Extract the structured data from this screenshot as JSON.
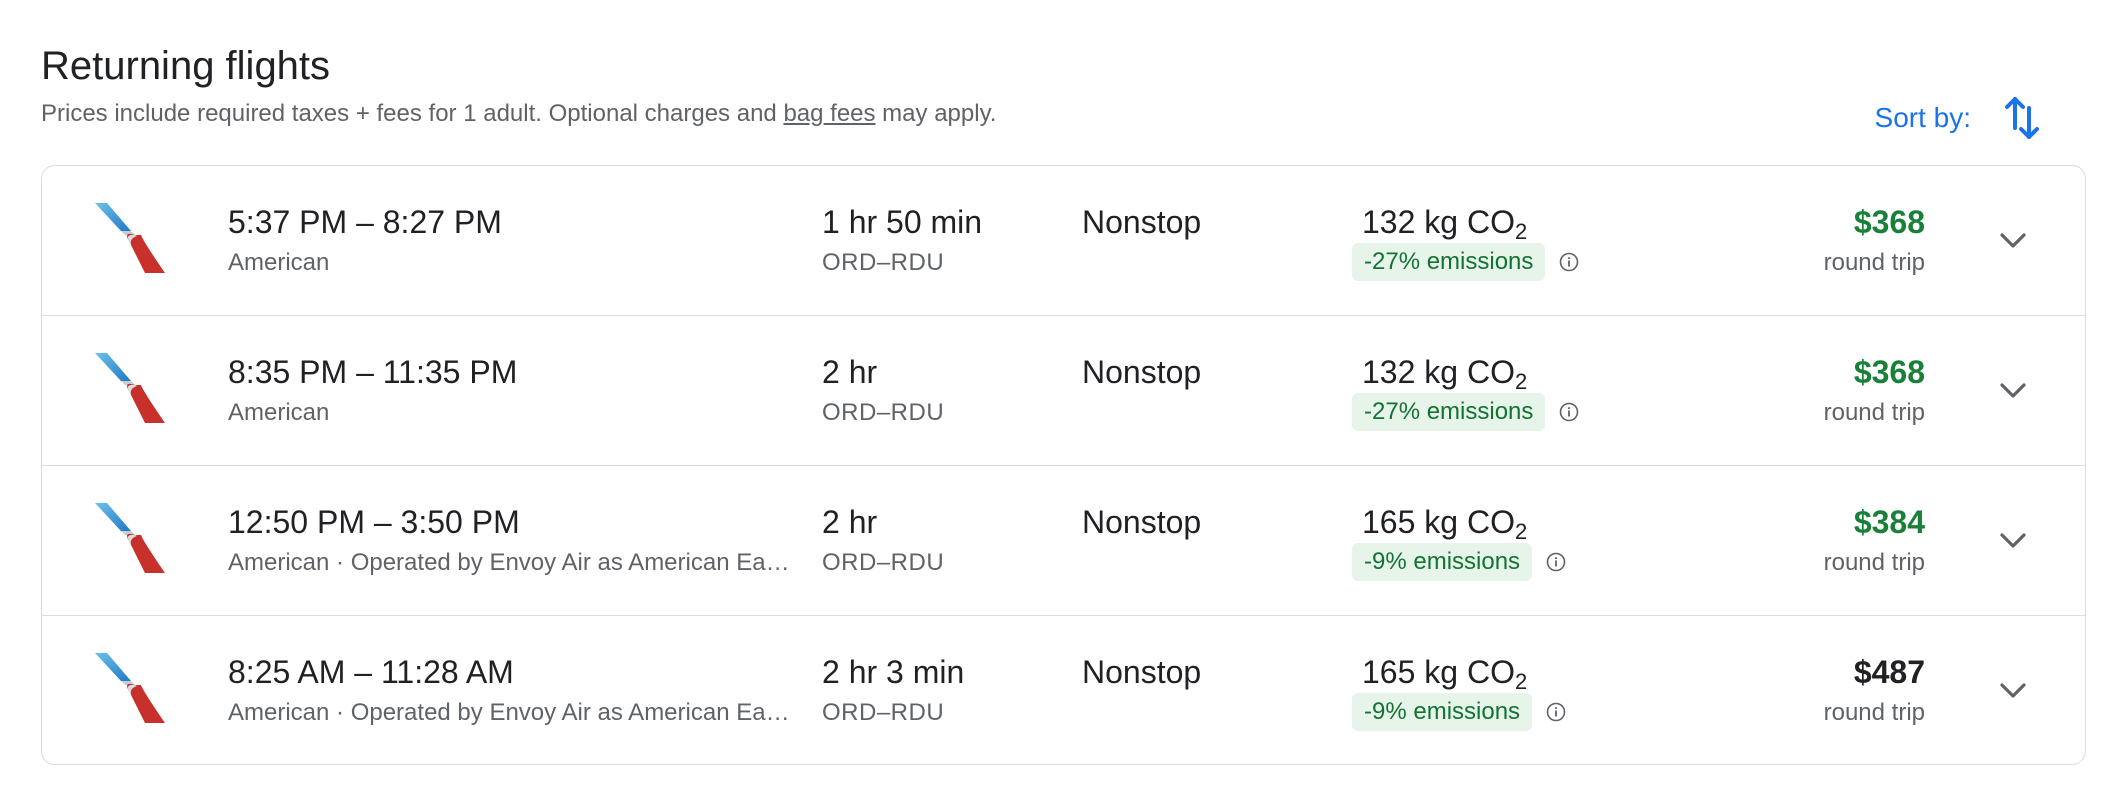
{
  "header": {
    "title": "Returning flights",
    "subtitle_before_link": "Prices include required taxes + fees for 1 adult. Optional charges and ",
    "subtitle_link": "bag fees",
    "subtitle_after_link": " may apply.",
    "sort_label": "Sort by:",
    "sort_icon": "swap-vert-icon"
  },
  "colors": {
    "accent_blue": "#1a73e8",
    "price_green": "#188038",
    "price_default": "#202124",
    "badge_bg": "#e6f4ea",
    "badge_text": "#137333"
  },
  "icons": {
    "airline_logo": "american-airlines-logo",
    "info": "info-icon",
    "expand": "chevron-down-icon"
  },
  "flights": [
    {
      "times": "5:37 PM – 8:27 PM",
      "airline": "American",
      "duration": "1 hr 50 min",
      "route": "ORD–RDU",
      "stops": "Nonstop",
      "co2_value": "132 kg CO",
      "co2_sub": "2",
      "emissions": "-27% emissions",
      "price": "$368",
      "price_color": "#188038",
      "price_type": "round trip"
    },
    {
      "times": "8:35 PM – 11:35 PM",
      "airline": "American",
      "duration": "2 hr",
      "route": "ORD–RDU",
      "stops": "Nonstop",
      "co2_value": "132 kg CO",
      "co2_sub": "2",
      "emissions": "-27% emissions",
      "price": "$368",
      "price_color": "#188038",
      "price_type": "round trip"
    },
    {
      "times": "12:50 PM – 3:50 PM",
      "airline": "American · Operated by Envoy Air as American Ea…",
      "duration": "2 hr",
      "route": "ORD–RDU",
      "stops": "Nonstop",
      "co2_value": "165 kg CO",
      "co2_sub": "2",
      "emissions": "-9% emissions",
      "price": "$384",
      "price_color": "#188038",
      "price_type": "round trip"
    },
    {
      "times": "8:25 AM – 11:28 AM",
      "airline": "American · Operated by Envoy Air as American Ea…",
      "duration": "2 hr 3 min",
      "route": "ORD–RDU",
      "stops": "Nonstop",
      "co2_value": "165 kg CO",
      "co2_sub": "2",
      "emissions": "-9% emissions",
      "price": "$487",
      "price_color": "#202124",
      "price_type": "round trip"
    }
  ]
}
